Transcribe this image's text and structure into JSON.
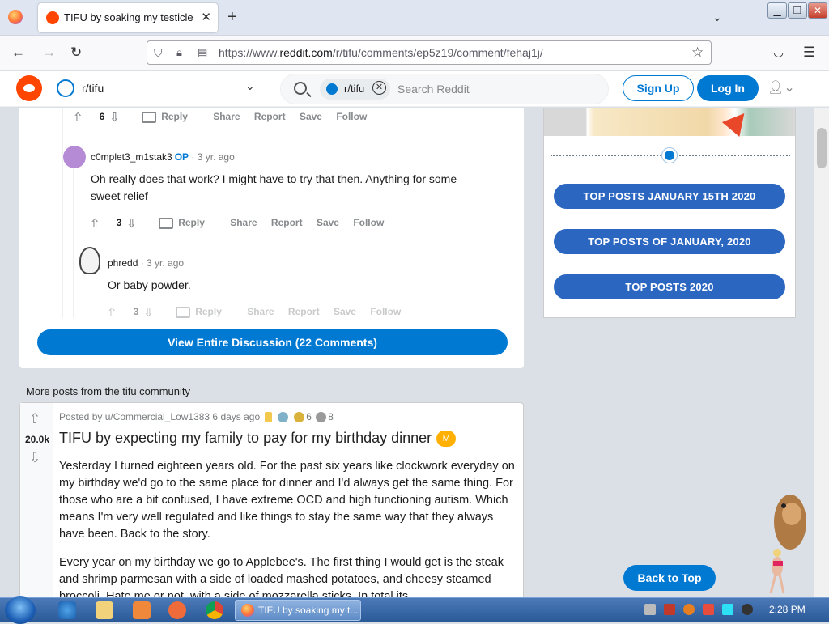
{
  "browser": {
    "tab_title": "TIFU by soaking my testicles in",
    "url_prefix": "https://www.",
    "url_host": "reddit.com",
    "url_path": "/r/tifu/comments/ep5z19/comment/fehaj1j/"
  },
  "header": {
    "subreddit": "r/tifu",
    "search_chip": "r/tifu",
    "search_placeholder": "Search Reddit",
    "signup": "Sign Up",
    "login": "Log In"
  },
  "comments": [
    {
      "actions": {
        "votes": "6",
        "reply": "Reply",
        "share": "Share",
        "report": "Report",
        "save": "Save",
        "follow": "Follow"
      }
    },
    {
      "user": "c0mplet3_m1stak3",
      "op": "OP",
      "ago": "· 3 yr. ago",
      "body": "Oh really does that work? I might have to try that then. Anything for some sweet relief",
      "actions": {
        "votes": "3",
        "reply": "Reply",
        "share": "Share",
        "report": "Report",
        "save": "Save",
        "follow": "Follow"
      }
    },
    {
      "user": "phredd",
      "ago": "· 3 yr. ago",
      "body": "Or baby powder.",
      "actions": {
        "votes": "3",
        "reply": "Reply",
        "share": "Share",
        "report": "Report",
        "save": "Save",
        "follow": "Follow"
      }
    }
  ],
  "view_all": "View Entire Discussion (22 Comments)",
  "more_label": "More posts from the tifu community",
  "post": {
    "score": "20.0k",
    "meta": "Posted by u/Commercial_Low1383 6 days ago",
    "award_count_1": "6",
    "award_count_2": "8",
    "title": "TIFU by expecting my family to pay for my birthday dinner",
    "flair": "M",
    "para1": "Yesterday I turned eighteen years old. For the past six years like clockwork everyday on my birthday we'd go to the same place for dinner and I'd always get the same thing. For those who are a bit confused, I have extreme OCD and high functioning autism. Which means I'm very well regulated and like things to stay the same way that they always have been. Back to the story.",
    "para2": "Every year on my birthday we go to Applebee's. The first thing I would get is the steak and shrimp parmesan with a side of loaded mashed potatoes, and cheesy steamed broccoli. Hate me or not, with a side of mozzarella sticks. In total its"
  },
  "sidebar": {
    "buttons": [
      "TOP POSTS JANUARY 15TH 2020",
      "TOP POSTS OF JANUARY, 2020",
      "TOP POSTS 2020"
    ]
  },
  "back_to_top": "Back to Top",
  "taskbar": {
    "task_label": "TIFU by soaking my t...",
    "clock": "2:28 PM"
  }
}
